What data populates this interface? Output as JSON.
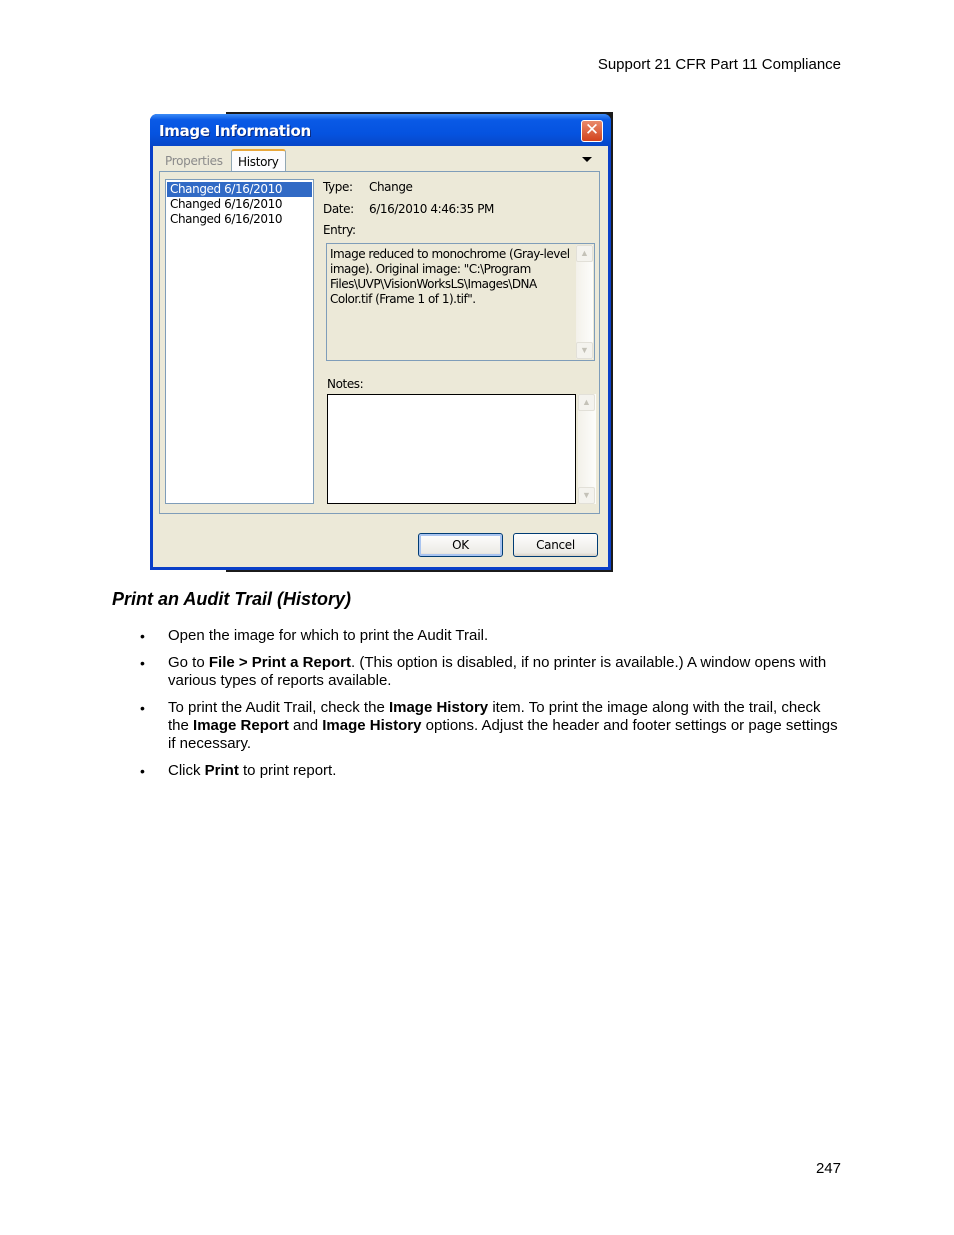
{
  "page": {
    "running_header": "Support 21 CFR Part 11 Compliance",
    "page_number": "247"
  },
  "dialog": {
    "title": "Image Information",
    "close_icon": "close-icon",
    "tabs": [
      {
        "label": "Properties",
        "active": false
      },
      {
        "label": "History",
        "active": true
      }
    ],
    "tab_menu_icon": "chevron-down-icon",
    "history_items": [
      {
        "label": "Changed 6/16/2010",
        "selected": true
      },
      {
        "label": "Changed 6/16/2010",
        "selected": false
      },
      {
        "label": "Changed 6/16/2010",
        "selected": false
      }
    ],
    "type_label": "Type:",
    "type_value": "Change",
    "date_label": "Date:",
    "date_value": "6/16/2010 4:46:35 PM",
    "entry_label": "Entry:",
    "entry_text": "Image reduced to monochrome (Gray-level image). Original image: \"C:\\Program Files\\UVP\\VisionWorksLS\\Images\\DNA Color.tif (Frame 1 of 1).tif\".",
    "notes_label": "Notes:",
    "notes_value": "",
    "scroll_up_glyph": "▲",
    "scroll_down_glyph": "▼",
    "ok_label": "OK",
    "cancel_label": "Cancel",
    "close_glyph": "✕"
  },
  "section": {
    "heading": "Print an Audit Trail (History)",
    "bullets": [
      [
        {
          "text": "Open the image for which to print the Audit Trail.",
          "bold": false
        }
      ],
      [
        {
          "text": "Go to ",
          "bold": false
        },
        {
          "text": "File > Print a Report",
          "bold": true
        },
        {
          "text": ". (This option is disabled, if no printer is available.) A window opens with various types of reports available.",
          "bold": false
        }
      ],
      [
        {
          "text": "To print the Audit Trail, check the ",
          "bold": false
        },
        {
          "text": "Image History",
          "bold": true
        },
        {
          "text": " item. To print the image along with the trail, check the ",
          "bold": false
        },
        {
          "text": "Image Report",
          "bold": true
        },
        {
          "text": " and ",
          "bold": false
        },
        {
          "text": "Image History",
          "bold": true
        },
        {
          "text": " options. Adjust the header and footer settings or page settings if necessary.",
          "bold": false
        }
      ],
      [
        {
          "text": "Click ",
          "bold": false
        },
        {
          "text": "Print",
          "bold": true
        },
        {
          "text": " to print report.",
          "bold": false
        }
      ]
    ]
  }
}
